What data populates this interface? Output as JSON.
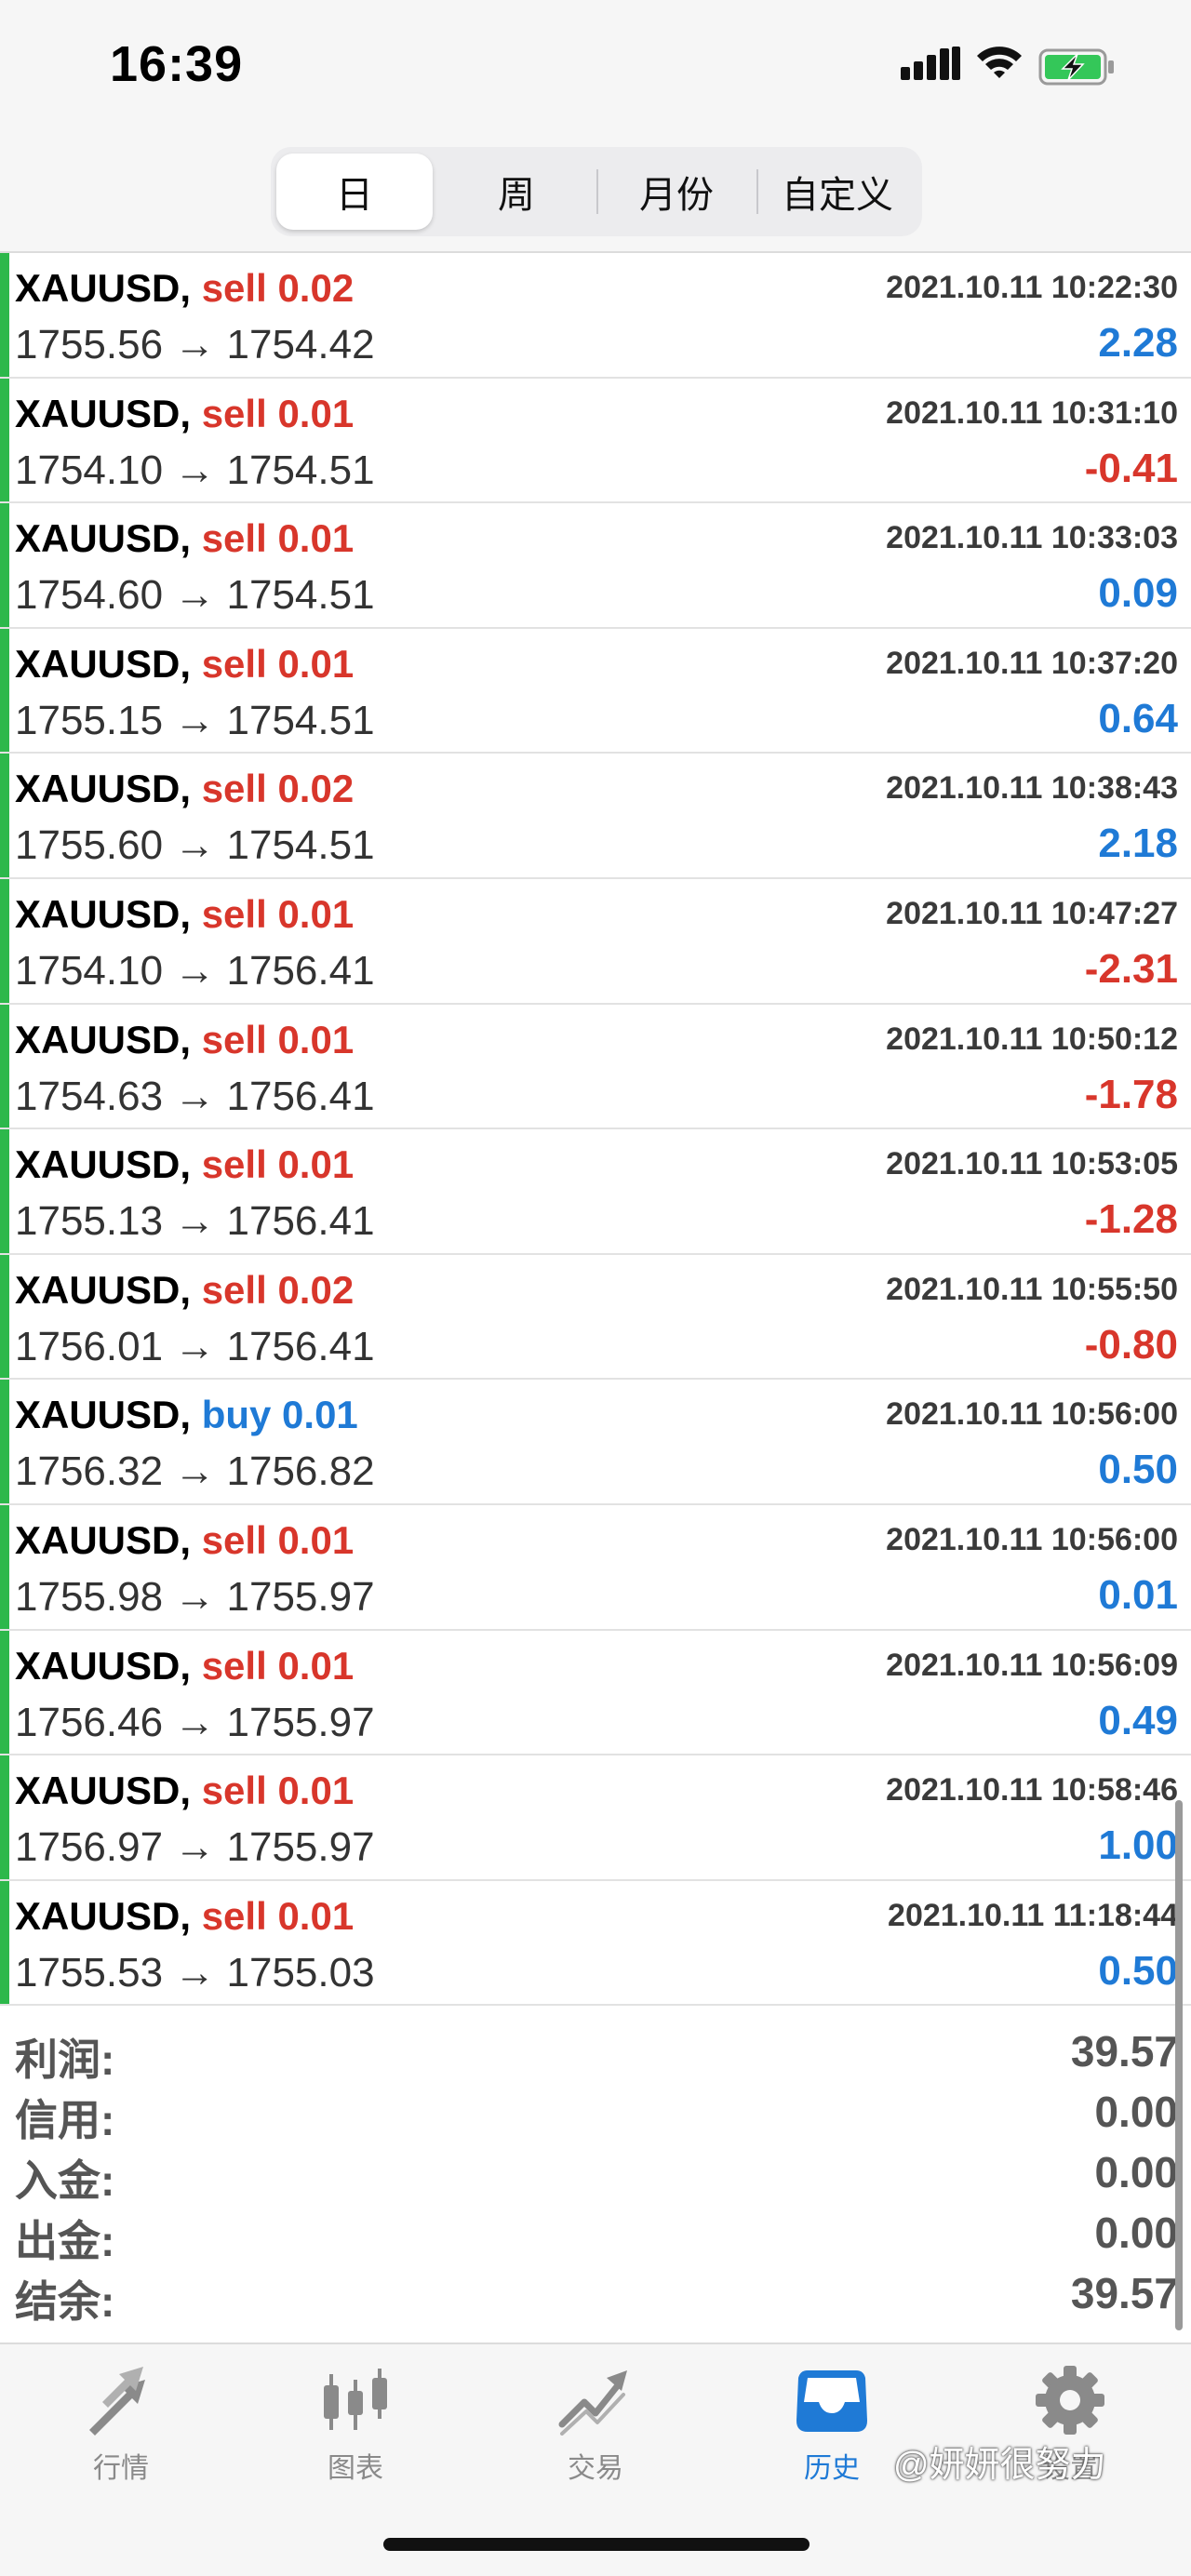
{
  "status_bar": {
    "time": "16:39"
  },
  "period_tabs": [
    {
      "label": "日",
      "active": true
    },
    {
      "label": "周",
      "active": false
    },
    {
      "label": "月份",
      "active": false
    },
    {
      "label": "自定义",
      "active": false
    }
  ],
  "trades": [
    {
      "symbol": "XAUUSD,",
      "side": "sell",
      "volume": "0.02",
      "time": "2021.10.11 10:22:30",
      "prices": "1755.56 → 1754.42",
      "profit": "2.28"
    },
    {
      "symbol": "XAUUSD,",
      "side": "sell",
      "volume": "0.01",
      "time": "2021.10.11 10:31:10",
      "prices": "1754.10 → 1754.51",
      "profit": "-0.41"
    },
    {
      "symbol": "XAUUSD,",
      "side": "sell",
      "volume": "0.01",
      "time": "2021.10.11 10:33:03",
      "prices": "1754.60 → 1754.51",
      "profit": "0.09"
    },
    {
      "symbol": "XAUUSD,",
      "side": "sell",
      "volume": "0.01",
      "time": "2021.10.11 10:37:20",
      "prices": "1755.15 → 1754.51",
      "profit": "0.64"
    },
    {
      "symbol": "XAUUSD,",
      "side": "sell",
      "volume": "0.02",
      "time": "2021.10.11 10:38:43",
      "prices": "1755.60 → 1754.51",
      "profit": "2.18"
    },
    {
      "symbol": "XAUUSD,",
      "side": "sell",
      "volume": "0.01",
      "time": "2021.10.11 10:47:27",
      "prices": "1754.10 → 1756.41",
      "profit": "-2.31"
    },
    {
      "symbol": "XAUUSD,",
      "side": "sell",
      "volume": "0.01",
      "time": "2021.10.11 10:50:12",
      "prices": "1754.63 → 1756.41",
      "profit": "-1.78"
    },
    {
      "symbol": "XAUUSD,",
      "side": "sell",
      "volume": "0.01",
      "time": "2021.10.11 10:53:05",
      "prices": "1755.13 → 1756.41",
      "profit": "-1.28"
    },
    {
      "symbol": "XAUUSD,",
      "side": "sell",
      "volume": "0.02",
      "time": "2021.10.11 10:55:50",
      "prices": "1756.01 → 1756.41",
      "profit": "-0.80"
    },
    {
      "symbol": "XAUUSD,",
      "side": "buy",
      "volume": "0.01",
      "time": "2021.10.11 10:56:00",
      "prices": "1756.32 → 1756.82",
      "profit": "0.50"
    },
    {
      "symbol": "XAUUSD,",
      "side": "sell",
      "volume": "0.01",
      "time": "2021.10.11 10:56:00",
      "prices": "1755.98 → 1755.97",
      "profit": "0.01"
    },
    {
      "symbol": "XAUUSD,",
      "side": "sell",
      "volume": "0.01",
      "time": "2021.10.11 10:56:09",
      "prices": "1756.46 → 1755.97",
      "profit": "0.49"
    },
    {
      "symbol": "XAUUSD,",
      "side": "sell",
      "volume": "0.01",
      "time": "2021.10.11 10:58:46",
      "prices": "1756.97 → 1755.97",
      "profit": "1.00"
    },
    {
      "symbol": "XAUUSD,",
      "side": "sell",
      "volume": "0.01",
      "time": "2021.10.11 11:18:44",
      "prices": "1755.53 → 1755.03",
      "profit": "0.50"
    }
  ],
  "summary": [
    {
      "label": "利润:",
      "value": "39.57"
    },
    {
      "label": "信用:",
      "value": "0.00"
    },
    {
      "label": "入金:",
      "value": "0.00"
    },
    {
      "label": "出金:",
      "value": "0.00"
    },
    {
      "label": "结余:",
      "value": "39.57"
    }
  ],
  "tab_bar": [
    {
      "label": "行情",
      "icon": "quotes-arrows-icon",
      "active": false
    },
    {
      "label": "图表",
      "icon": "candlestick-chart-icon",
      "active": false
    },
    {
      "label": "交易",
      "icon": "trade-trend-icon",
      "active": false
    },
    {
      "label": "历史",
      "icon": "history-tray-icon",
      "active": true
    },
    {
      "label": "设置",
      "icon": "gear-icon",
      "active": false
    }
  ],
  "watermark": "@妍妍很努力",
  "colors": {
    "accent": "#1f7ad6",
    "loss": "#d8362b",
    "bar": "#2db84b"
  }
}
